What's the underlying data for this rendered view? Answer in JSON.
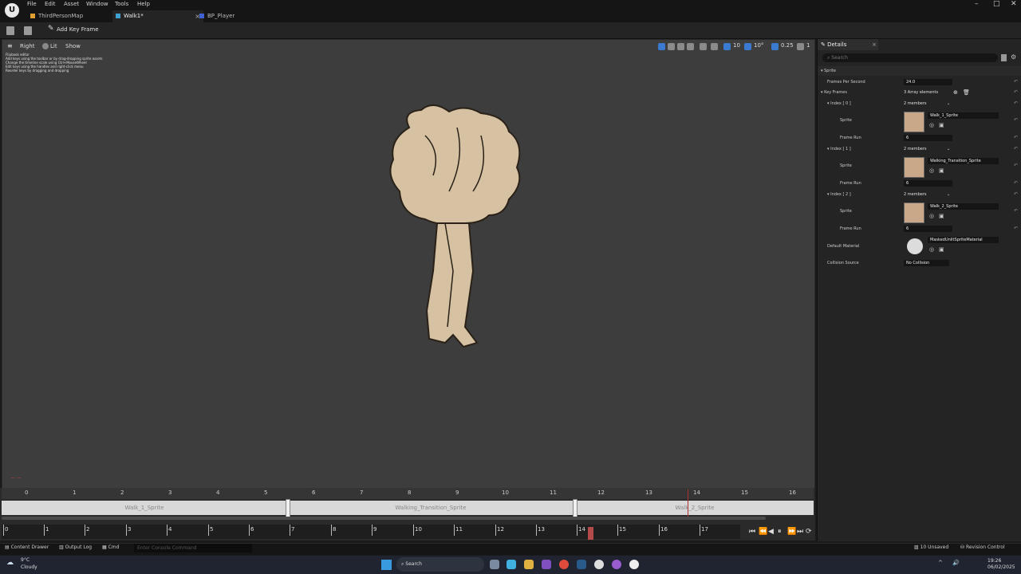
{
  "menu": [
    "File",
    "Edit",
    "Asset",
    "Window",
    "Tools",
    "Help"
  ],
  "tabs": [
    {
      "label": "ThirdPersonMap",
      "active": false,
      "color": "#e0a030"
    },
    {
      "label": "Walk1*",
      "active": true,
      "color": "#40a0d0"
    },
    {
      "label": "BP_Player",
      "active": false,
      "color": "#4060d0"
    }
  ],
  "toolbar": {
    "add_key_frame": "Add Key Frame"
  },
  "viewport": {
    "view_mode": "Right",
    "lit": "Lit",
    "show": "Show",
    "notes": [
      "Flipbook editor",
      "Add keys using the toolbar or by drag-dropping sprite assets",
      "Change the timeline scale using Ctrl+MouseWheel",
      "Edit keys using the handles and right-click menu",
      "Reorder keys by dragging and dropping"
    ],
    "grid_value": "10",
    "rotation_value": "10°",
    "scale_value": "0.25",
    "camera_speed": "1"
  },
  "timeline": {
    "ruler": [
      "0",
      "1",
      "2",
      "3",
      "4",
      "5",
      "6",
      "7",
      "8",
      "9",
      "10",
      "11",
      "12",
      "13",
      "14",
      "15",
      "16"
    ],
    "segments": [
      "Walk_1_Sprite",
      "Walking_Transition_Sprite",
      "Walk_2_Sprite"
    ],
    "scale": [
      "0",
      "1",
      "2",
      "3",
      "4",
      "5",
      "6",
      "7",
      "8",
      "9",
      "10",
      "11",
      "12",
      "13",
      "14",
      "15",
      "16",
      "17"
    ],
    "current_frame": 14
  },
  "details": {
    "tab_label": "Details",
    "search_placeholder": "Search",
    "section": "Sprite",
    "frames_per_second_label": "Frames Per Second",
    "frames_per_second": "24.0",
    "key_frames_label": "Key Frames",
    "key_frames_count": "3 Array elements",
    "indices": [
      {
        "label": "Index [ 0 ]",
        "members": "2 members",
        "sprite": "Walk_1_Sprite",
        "frame_run": "6"
      },
      {
        "label": "Index [ 1 ]",
        "members": "2 members",
        "sprite": "Walking_Transition_Sprite",
        "frame_run": "6"
      },
      {
        "label": "Index [ 2 ]",
        "members": "2 members",
        "sprite": "Walk_2_Sprite",
        "frame_run": "6"
      }
    ],
    "sprite_label": "Sprite",
    "frame_run_label": "Frame Run",
    "default_material_label": "Default Material",
    "default_material": "MaskedUnlitSpriteMaterial",
    "collision_source_label": "Collision Source",
    "collision_source": "No Collision"
  },
  "status": {
    "content_drawer": "Content Drawer",
    "output_log": "Output Log",
    "cmd": "Cmd",
    "console_placeholder": "Enter Console Command",
    "unsaved": "10 Unsaved",
    "revision_control": "Revision Control"
  },
  "taskbar": {
    "temp": "9°C",
    "weather": "Cloudy",
    "search": "Search",
    "time": "19:26",
    "date": "06/02/2025"
  }
}
